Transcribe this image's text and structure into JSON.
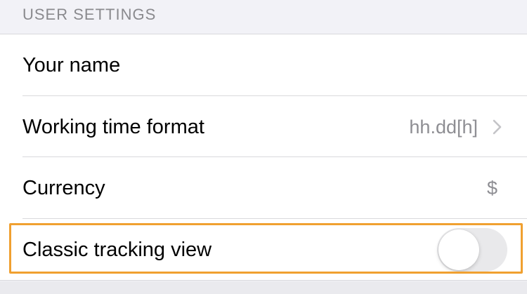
{
  "section": {
    "header": "USER SETTINGS"
  },
  "rows": [
    {
      "label": "Your name",
      "value": ""
    },
    {
      "label": "Working time format",
      "value": "hh.dd[h]",
      "chevron": "chevron-right-icon"
    },
    {
      "label": "Currency",
      "value": "$"
    },
    {
      "label": "Classic tracking view",
      "toggle": false
    }
  ],
  "colors": {
    "highlight": "#f0a030",
    "secondary_text": "#8e8e93",
    "toggle_off": "#e9e9eb"
  }
}
